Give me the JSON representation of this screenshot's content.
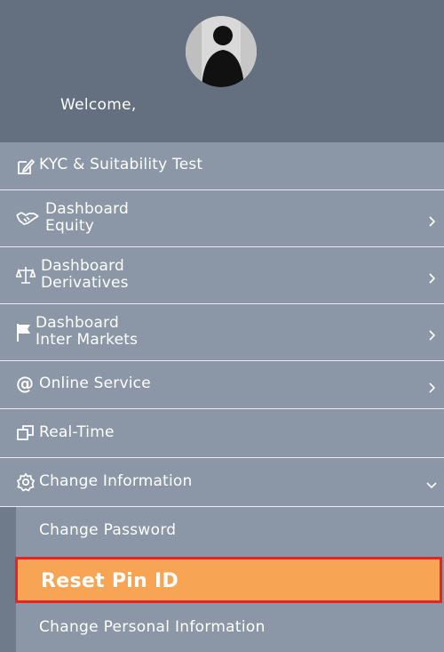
{
  "header": {
    "welcome": "Welcome,"
  },
  "menu": {
    "kyc": "KYC & Suitability Test",
    "equity": {
      "line1": "Dashboard",
      "line2": "Equity"
    },
    "derivatives": {
      "line1": "Dashboard",
      "line2": "Derivatives"
    },
    "inter": {
      "line1": "Dashboard",
      "line2": "Inter Markets"
    },
    "online": "Online Service",
    "realtime": "Real-Time",
    "change_info": "Change Information"
  },
  "submenu": {
    "change_password": "Change Password",
    "reset_pin": "Reset Pin ID",
    "change_personal": "Change Personal Information"
  },
  "icons": {
    "kyc": "edit-icon",
    "equity": "handshake-icon",
    "derivatives": "balance-scale-icon",
    "inter": "flag-icon",
    "online": "at-sign-icon",
    "realtime": "windows-icon",
    "change_info": "gear-icon"
  },
  "colors": {
    "header_bg": "#646f7f",
    "menu_bg": "#8b97a7",
    "highlight_bg": "#f7a554",
    "highlight_border": "#e3242b"
  }
}
